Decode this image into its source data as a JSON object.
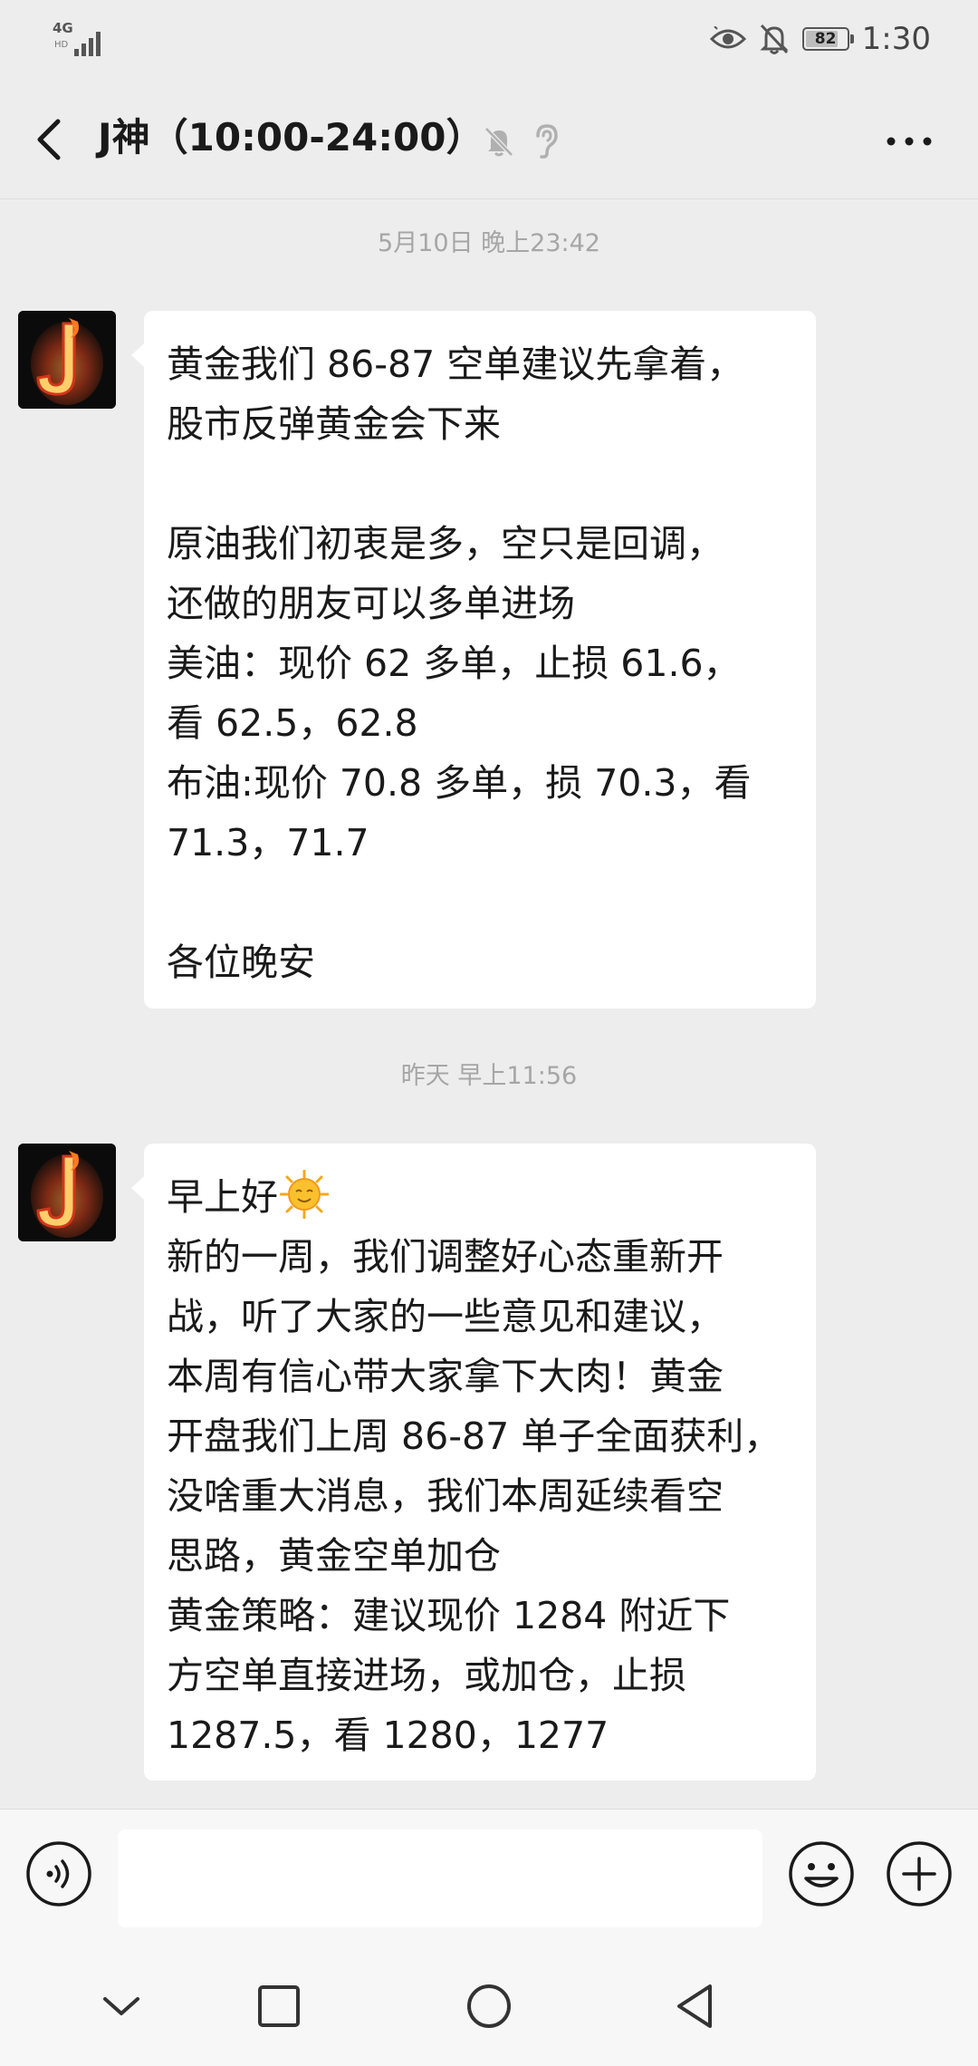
{
  "status_bar": {
    "network": "4G",
    "network_sub": "HD",
    "battery": "82",
    "battery_level": 0.82,
    "time": "1:30"
  },
  "header": {
    "title": "J神（10:00-24:00）",
    "icons": [
      "back-arrow-icon",
      "mute-bell-icon",
      "ear-icon",
      "more-icon"
    ]
  },
  "messages": [
    {
      "timestamp": "5月10日 晚上23:42",
      "lines": [
        "黄金我们 86-87 空单建议先拿着，",
        "股市反弹黄金会下来",
        "",
        "原油我们初衷是多，空只是回调，",
        "还做的朋友可以多单进场",
        "美油：现价 62 多单，止损 61.6，",
        "看 62.5，62.8",
        "布油:现价 70.8 多单，损 70.3，看",
        "71.3，71.7",
        "",
        "各位晚安"
      ]
    },
    {
      "timestamp": "昨天 早上11:56",
      "first_line": "早上好",
      "emoji": "sun-face-emoji",
      "lines": [
        "新的一周，我们调整好心态重新开",
        "战，听了大家的一些意见和建议，",
        "本周有信心带大家拿下大肉！黄金",
        "开盘我们上周 86-87 单子全面获利，",
        "没啥重大消息，我们本周延续看空",
        "思路，黄金空单加仓",
        "黄金策略：建议现价 1284 附近下",
        "方空单直接进场，或加仓，止损",
        "1287.5，看 1280，1277"
      ]
    }
  ],
  "input_bar": {
    "value": "",
    "icons": [
      "voice-icon",
      "emoji-icon",
      "plus-icon"
    ]
  },
  "nav_bar": {
    "icons": [
      "chevron-down-icon",
      "recents-square-icon",
      "home-circle-icon",
      "back-triangle-icon"
    ]
  },
  "colors": {
    "background": "#ededed",
    "bubble": "#ffffff",
    "timestamp": "#a6a6a6",
    "text": "#1a1a1a"
  }
}
